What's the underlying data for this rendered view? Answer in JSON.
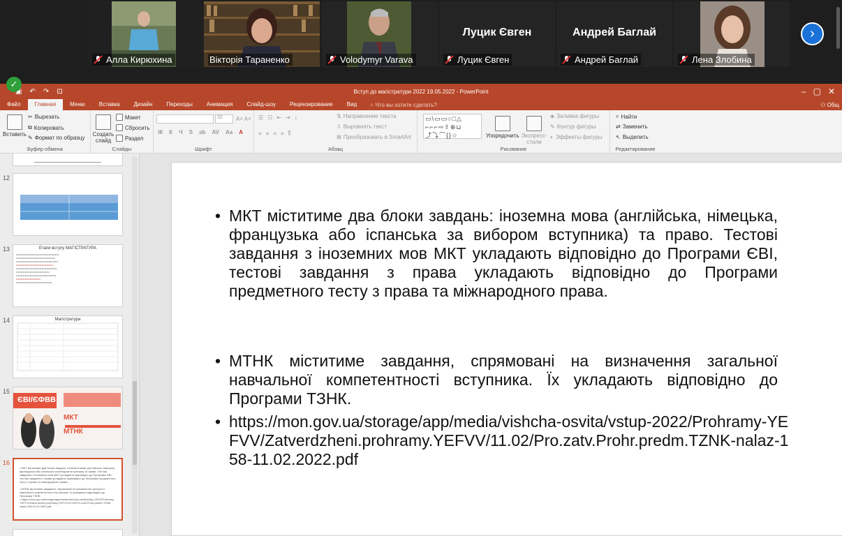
{
  "participants": [
    {
      "name": "Алла Кирюхина",
      "video": true,
      "muted": true,
      "photo": "woman-outdoor"
    },
    {
      "name": "Вікторія Тараненко",
      "video": true,
      "muted": false,
      "active": true,
      "photo": "woman-library"
    },
    {
      "name": "Volodymyr Varava",
      "video": true,
      "muted": true,
      "photo": "man-suit"
    },
    {
      "name": "Луцик Євген",
      "video": false,
      "muted": true
    },
    {
      "name": "Андрей Баглай",
      "video": false,
      "muted": true
    },
    {
      "name": "Лена Злобина",
      "video": true,
      "muted": true,
      "photo": "woman-car"
    }
  ],
  "next_page_icon": "chevron-right-icon",
  "security_icon": "shield-check-icon",
  "powerpoint": {
    "title": "Вступ до магістратури 2022 19.05.2022 - PowerPoint",
    "tabs": [
      "Файл",
      "Главная",
      "Меню",
      "Вставка",
      "Дизайн",
      "Переходы",
      "Анимация",
      "Слайд-шоу",
      "Рецензирование",
      "Вид"
    ],
    "active_tab": "Главная",
    "tell_me": "Что вы хотите сделать?",
    "account": "Общ",
    "ribbon": {
      "clipboard": {
        "paste": "Вставить",
        "cut": "Вырезать",
        "copy": "Копировать",
        "format_painter": "Формат по образцу",
        "group": "Буфер обмена"
      },
      "slides": {
        "new_slide": "Создать слайд",
        "layout": "Макет",
        "reset": "Сбросить",
        "section": "Раздел",
        "group": "Слайды"
      },
      "font": {
        "size": "32",
        "bold": "Ж",
        "italic": "К",
        "underline": "Ч",
        "strike": "S",
        "group": "Шрифт"
      },
      "paragraph": {
        "direction": "Направление текста",
        "align": "Выровнять текст",
        "smartart": "Преобразовать в SmartArt",
        "group": "Абзац"
      },
      "drawing": {
        "arrange": "Упорядочить",
        "styles": "Экспресс-стили",
        "fill": "Заливка фигуры",
        "outline": "Контур фигуры",
        "effects": "Эффекты фигуры",
        "group": "Рисование"
      },
      "editing": {
        "find": "Найти",
        "replace": "Заменить",
        "select": "Выделить",
        "group": "Редактирование"
      }
    }
  },
  "thumbnails": [
    {
      "num": "12"
    },
    {
      "num": "13",
      "title": "Етапи вступу МАГІСТРАТУРА"
    },
    {
      "num": "14",
      "title": "Магістратура"
    },
    {
      "num": "15",
      "label": "МКТ",
      "label2": "МТНК",
      "banner": "ЄВІ/ЄФВВ"
    },
    {
      "num": "16",
      "selected": true
    }
  ],
  "slide": {
    "bullets": [
      "МКТ міститиме два блоки завдань:  іноземна мова (англійська, німецька, французька або іспанська за вибором вступника) та право. Тестові завдання з іноземних мов МКТ укладають відповідно до Програми ЄВІ, тестові завдання з права укладають відповідно до Програми предметного тесту з права та міжнародного права.",
      "МТНК міститиме завдання, спрямовані на визначення загальної навчальної компетентності вступника. Їх укладають відповідно до Програми ТЗНК.",
      "https://mon.gov.ua/storage/app/media/vishcha-osvita/vstup-2022/Prohramy-YEFVV/Zatverdzheni.prohramy.YEFVV/11.02/Pro.zatv.Prohr.predm.TZNK-nalaz-158-11.02.2022.pdf"
    ]
  },
  "colors": {
    "ppt_accent": "#b7472a",
    "active_speaker": "#9bd24a",
    "next_button": "#1a72d8",
    "selected_thumb": "#d2502d"
  }
}
